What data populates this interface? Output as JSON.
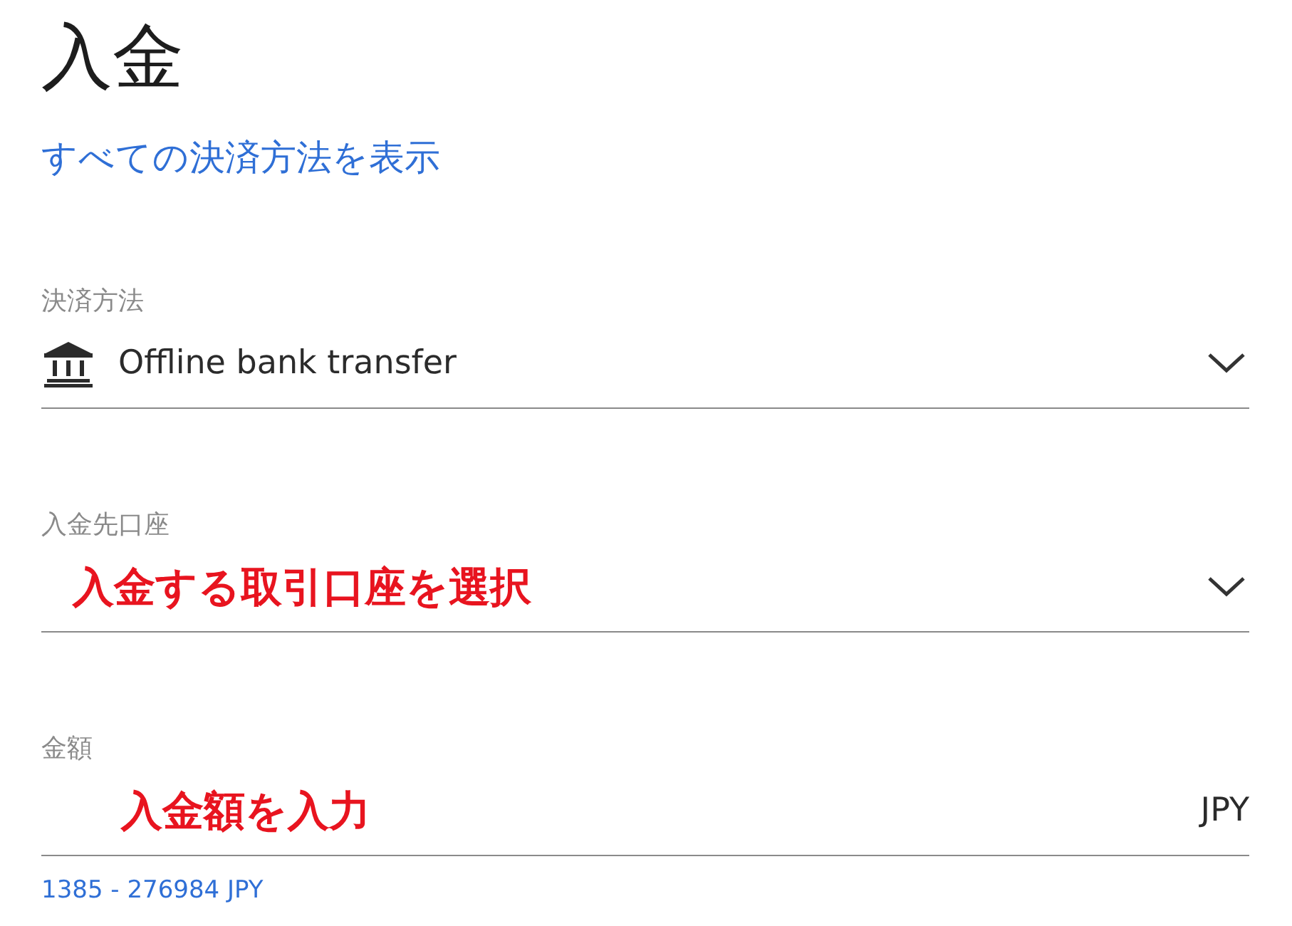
{
  "title": "入金",
  "link": "すべての決済方法を表示",
  "fields": [
    {
      "kind": "select",
      "label": "決済方法",
      "value": "Offline bank transfer"
    },
    {
      "kind": "select",
      "label": "入金先口座",
      "annotation": "入金する取引口座を選択"
    },
    {
      "kind": "amount",
      "label": "金額",
      "annotation": "入金額を入力",
      "suffix": "JPY",
      "hint": "1385 - 276984 JPY"
    }
  ]
}
